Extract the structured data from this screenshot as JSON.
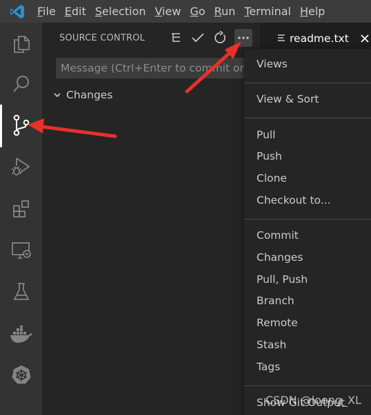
{
  "menubar": {
    "items": [
      "File",
      "Edit",
      "Selection",
      "View",
      "Go",
      "Run",
      "Terminal",
      "Help"
    ],
    "mnemonics": [
      "F",
      "E",
      "S",
      "V",
      "G",
      "R",
      "T",
      "H"
    ]
  },
  "activity_bar": {
    "icons": [
      "explorer-icon",
      "search-icon",
      "source-control-icon",
      "run-debug-icon",
      "extensions-icon",
      "remote-explorer-icon",
      "testing-icon",
      "docker-icon",
      "kubernetes-icon"
    ],
    "active": "source-control-icon"
  },
  "sidebar": {
    "title": "SOURCE CONTROL",
    "commit_placeholder": "Message (Ctrl+Enter to commit on",
    "changes_label": "Changes"
  },
  "tab": {
    "label": "readme.txt"
  },
  "context_menu": {
    "groups": [
      [
        "Views"
      ],
      [
        "View & Sort"
      ],
      [
        "Pull",
        "Push",
        "Clone",
        "Checkout to..."
      ],
      [
        "Commit",
        "Changes",
        "Pull, Push",
        "Branch",
        "Remote",
        "Stash",
        "Tags"
      ],
      [
        "Show Git Output"
      ]
    ]
  },
  "watermark": "CSDN @loong_XL",
  "colors": {
    "accent_blue": "#2b8fd6",
    "annotation_red": "#e8302a"
  }
}
